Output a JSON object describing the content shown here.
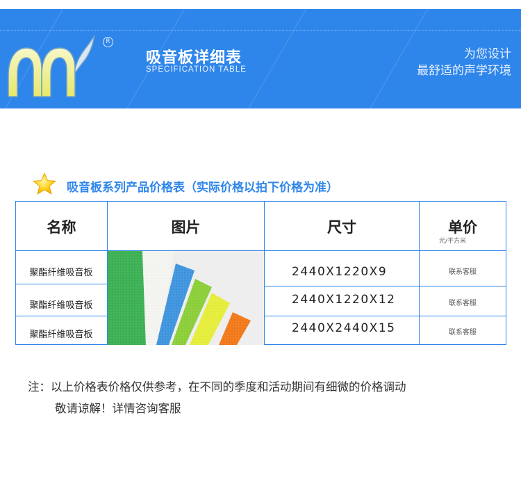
{
  "banner": {
    "title_cn": "吸音板详细表",
    "title_en": "SPECIFICATION TABLE",
    "registered_mark": "R",
    "slogan_line1": "为您设计",
    "slogan_line2": "最舒适的声学环境",
    "bg_color": "#2f86ea"
  },
  "section": {
    "title": "吸音板系列产品价格表（实际价格以拍下价格为准）",
    "icon": "star-icon"
  },
  "table": {
    "headers": {
      "name": "名称",
      "image": "图片",
      "size": "尺寸",
      "price": "单价",
      "price_unit": "元/平方米"
    },
    "rows": [
      {
        "name": "聚酯纤维吸音板",
        "size": "2440X1220X9",
        "price": "联系客服"
      },
      {
        "name": "聚酯纤维吸音板",
        "size": "2440X1220X12",
        "price": "联系客服"
      },
      {
        "name": "聚酯纤维吸音板",
        "size": "2440X2440X15",
        "price": "联系客服"
      }
    ],
    "border_color": "#2f86ea"
  },
  "notes": {
    "line1": "注：以上价格表价格仅供参考，在不同的季度和活动期间有细微的价格调动",
    "line2": "敬请谅解！详情咨询客服"
  }
}
